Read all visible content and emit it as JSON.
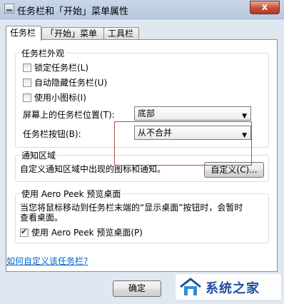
{
  "window": {
    "title": "任务栏和「开始」菜单属性",
    "close_glyph": "x"
  },
  "tabs": [
    {
      "label": "任务栏",
      "active": true
    },
    {
      "label": "「开始」菜单",
      "active": false
    },
    {
      "label": "工具栏",
      "active": false
    }
  ],
  "appearance": {
    "group_title": "任务栏外观",
    "lock_taskbar": {
      "label": "锁定任务栏(L)",
      "checked": false
    },
    "auto_hide": {
      "label": "自动隐藏任务栏(U)",
      "checked": false
    },
    "small_icons": {
      "label": "使用小图标(I)",
      "checked": false
    },
    "location_label": "屏幕上的任务栏位置(T):",
    "location_value": "底部",
    "buttons_label": "任务栏按钮(B):",
    "buttons_value": "从不合并"
  },
  "notification": {
    "group_title": "通知区域",
    "description": "自定义通知区域中出现的图标和通知。",
    "customize_button": "自定义(C)..."
  },
  "aero_peek": {
    "group_title": "使用 Aero Peek 预览桌面",
    "description_line1": "当您将鼠标移动到任务栏末端的“显示桌面”按钮时，会暂时",
    "description_line2": "查看桌面。",
    "use_peek": {
      "label": "使用 Aero Peek 预览桌面(P)",
      "checked": true
    }
  },
  "help_link": "如何自定义该任务栏?",
  "footer": {
    "ok_button": "确定"
  },
  "watermark": {
    "text": "系统之家",
    "colors": {
      "brand": "#1d4f9c"
    }
  },
  "colors": {
    "highlight_box": "#b84a4a",
    "link": "#0066cc"
  }
}
